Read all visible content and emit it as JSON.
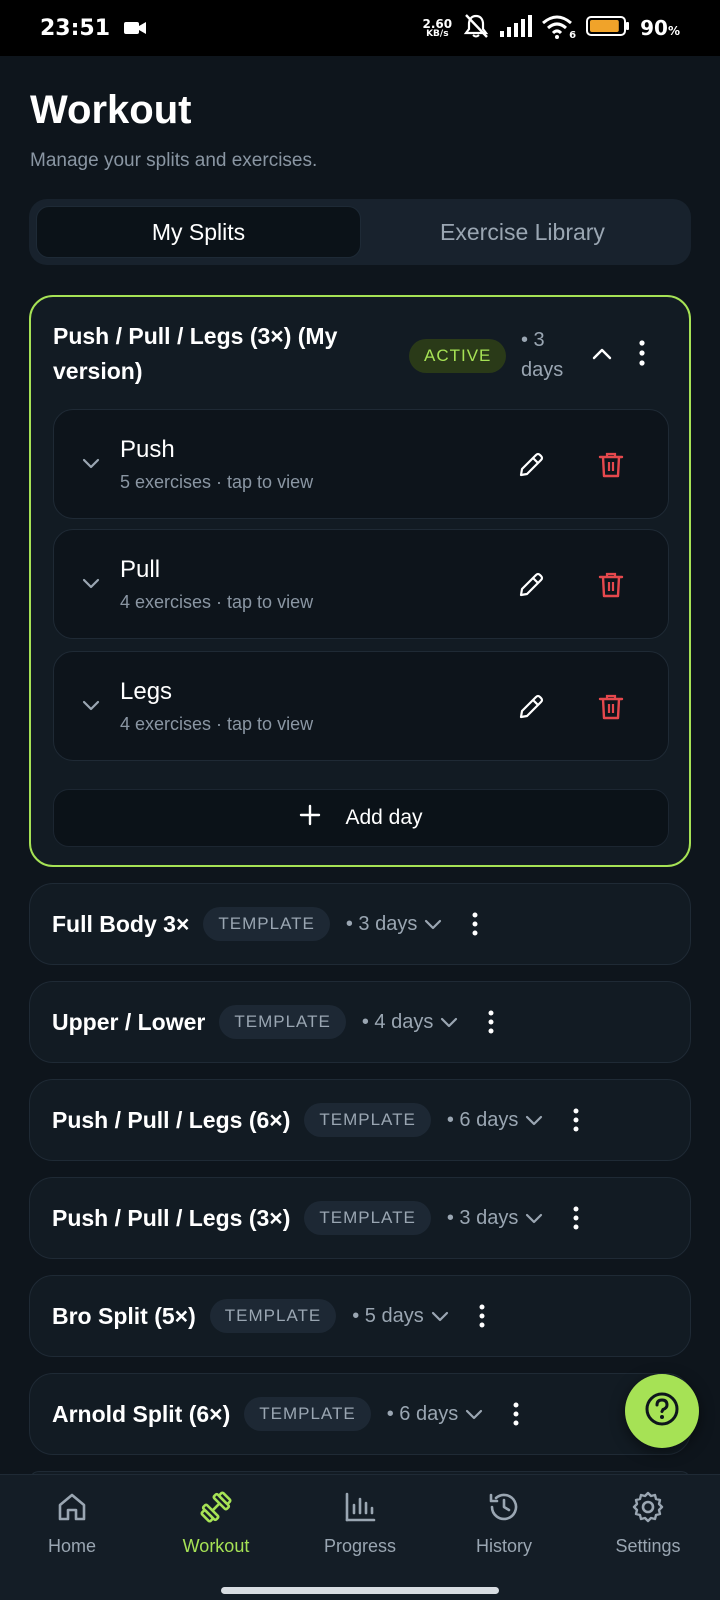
{
  "status_bar": {
    "time": "23:51",
    "net_speed_value": "2.60",
    "net_speed_unit": "KB/s",
    "wifi_label": "6",
    "battery_percent": "90",
    "battery_unit": "%",
    "battery_level": 0.9,
    "icons": [
      "video-camera-icon",
      "mute-alarm-icon",
      "signal-icon",
      "wifi-icon",
      "battery-icon"
    ]
  },
  "header": {
    "title": "Workout",
    "subtitle": "Manage your splits and exercises."
  },
  "tabs": [
    {
      "label": "My Splits",
      "active": true
    },
    {
      "label": "Exercise Library",
      "active": false
    }
  ],
  "active_split": {
    "title": "Push / Pull / Legs (3×) (My version)",
    "badge": "ACTIVE",
    "days": "• 3 days",
    "days_line1": "• 3",
    "days_line2": "days",
    "day_list": [
      {
        "name": "Push",
        "meta": "5 exercises · tap to view"
      },
      {
        "name": "Pull",
        "meta": "4 exercises · tap to view"
      },
      {
        "name": "Legs",
        "meta": "4 exercises · tap to view"
      }
    ],
    "add_day_label": "Add day"
  },
  "templates": [
    {
      "name": "Full Body 3×",
      "badge": "TEMPLATE",
      "days": "• 3 days"
    },
    {
      "name": "Upper / Lower",
      "badge": "TEMPLATE",
      "days": "• 4 days"
    },
    {
      "name": "Push / Pull / Legs (6×)",
      "badge": "TEMPLATE",
      "days": "• 6 days"
    },
    {
      "name": "Push / Pull / Legs (3×)",
      "badge": "TEMPLATE",
      "days": "• 3 days"
    },
    {
      "name": "Bro Split (5×)",
      "badge": "TEMPLATE",
      "days": "• 5 days"
    },
    {
      "name": "Arnold Split (6×)",
      "badge": "TEMPLATE",
      "days": "• 6 days"
    }
  ],
  "nav": [
    {
      "label": "Home",
      "icon": "home-icon",
      "active": false
    },
    {
      "label": "Workout",
      "icon": "dumbbell-icon",
      "active": true
    },
    {
      "label": "Progress",
      "icon": "bar-chart-icon",
      "active": false
    },
    {
      "label": "History",
      "icon": "history-icon",
      "active": false
    },
    {
      "label": "Settings",
      "icon": "gear-icon",
      "active": false
    }
  ],
  "colors": {
    "accent": "#a6e255",
    "background": "#0e151c",
    "card": "#121b23",
    "danger": "#e5484d",
    "muted_text": "#8a96a3"
  }
}
